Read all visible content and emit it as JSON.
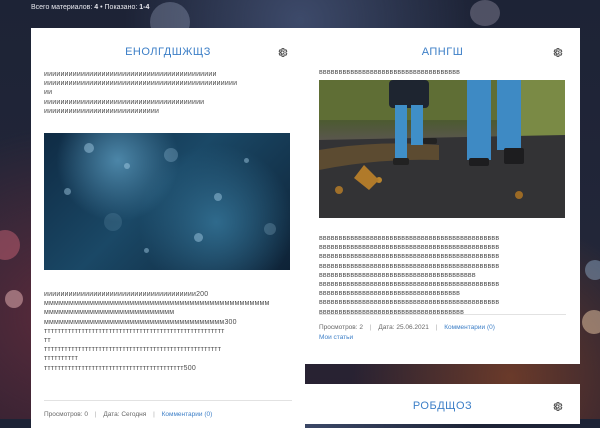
{
  "summary": {
    "label": "Всего материалов:",
    "count": "4",
    "sep": "•",
    "shown_label": "Показано:",
    "shown": "1-4"
  },
  "cards": [
    {
      "title": "ЕНОЛГДШЖЩЗ",
      "text_lines": [
        "ииииииииииииииииииииииииииииииииииииииииии",
        "иииииииииииииииииииииииииииииииииииииииииииииии",
        "ии",
        "иииииииииииииииииииииииииииииииииииииии",
        "ииииииииииииииииииииииииииии"
      ],
      "body_lines": [
        "иииииииииииииииииииииииииииииииииииии200",
        "ммммммммммммммммммммммммммммммммммммммммммммм",
        "мммммммммммммммммммммммммм",
        "мммммммммммммммммммммммммммммммммммм300",
        "ттттттттттттттттттттттттттттттттттттттттттттттттттттт",
        "тт",
        "тттттттттттттттттттттттттттттттттттттттттттттттттттт",
        "тттттттттт",
        "ттттттттттттттттттттттттттттттттттттттттт500"
      ],
      "meta": {
        "views_label": "Просмотров:",
        "views": "0",
        "date_label": "Дата:",
        "date": "Сегодня",
        "comments": "Комментарии (0)"
      }
    },
    {
      "title": "АПНГШ",
      "text_top": "вввввввввввввввввввввввввввввввввввв",
      "body_lines": [
        "вввввввввввввввввввввввввввввввввввввввввввввв",
        "вввввввввввввввввввввввввввввввввввввввввввввв",
        "вввввввввввввввввввввввввввввввввввввввввввввв",
        "вввввввввввввввввввввввввввввввввввввввввввввв",
        "вввввввввввввввввввввввввввввввввввввввв",
        "вввввввввввввввввввввввввввввввввввввввввввввв",
        "вввввввввввввввввввввввввввввввввввв",
        "вввввввввввввввввввввввввввввввввввввввввввввв",
        "ввввввввввввввввввввввввввввввввввввв"
      ],
      "meta": {
        "views_label": "Просмотров:",
        "views": "2",
        "date_label": "Дата:",
        "date": "25.06.2021",
        "comments": "Комментарии (0)",
        "my_articles": "Мои статьи"
      }
    },
    {
      "title": "РОБДЩОЗ"
    }
  ],
  "icons": {
    "settings": "gear-icon"
  },
  "colors": {
    "accent": "#3d7fc7",
    "text": "#4c4c4c"
  }
}
